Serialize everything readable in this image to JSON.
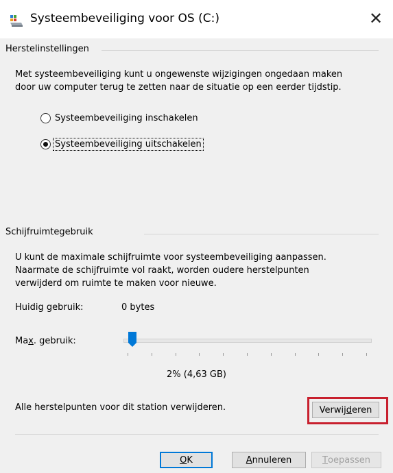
{
  "window": {
    "title": "Systeembeveiliging voor OS (C:)",
    "close_glyph": "✕"
  },
  "restore_settings": {
    "group_label": "Herstelinstellingen",
    "description_line1": "Met systeembeveiliging kunt u ongewenste wijzigingen ongedaan maken",
    "description_line2": "door uw computer terug te zetten naar de situatie op een eerder tijdstip.",
    "options": [
      {
        "label": "Systeembeveiliging inschakelen",
        "selected": false
      },
      {
        "label": "Systeembeveiliging uitschakelen",
        "selected": true
      }
    ]
  },
  "disk_usage": {
    "group_label": "Schijfruimtegebruik",
    "description_line1": "U kunt de maximale schijfruimte voor systeembeveiliging aanpassen.",
    "description_line2": "Naarmate de schijfruimte vol raakt, worden oudere herstelpunten",
    "description_line3": "verwijderd om ruimte te maken voor nieuwe.",
    "current_usage_label": "Huidig gebruik:",
    "current_usage_value": "0 bytes",
    "max_usage_label_pre": "Ma",
    "max_usage_label_accel": "x",
    "max_usage_label_post": ". gebruik:",
    "max_usage_fraction": 0.02,
    "max_usage_value": "2% (4,63 GB)",
    "delete_text": "Alle herstelpunten voor dit station verwijderen.",
    "delete_button_pre": "Verwij",
    "delete_button_accel": "d",
    "delete_button_post": "eren"
  },
  "buttons": {
    "ok_accel": "O",
    "ok_post": "K",
    "cancel_accel": "A",
    "cancel_post": "nnuleren",
    "apply_accel": "T",
    "apply_post": "oepassen"
  },
  "colors": {
    "accent": "#0078d7",
    "highlight": "#c8202e"
  }
}
